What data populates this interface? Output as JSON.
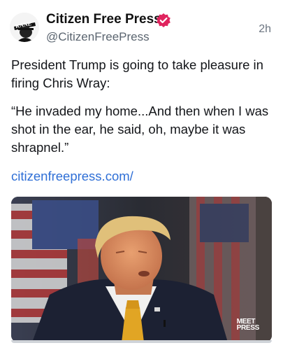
{
  "post": {
    "display_name": "Citizen Free Press",
    "handle": "@CitizenFreePress",
    "time": "2h",
    "avatar_icon": "kane-avatar-icon",
    "verified_icon": "verified-badge-icon",
    "verified_color": "#e0245e",
    "text_line_1": "President Trump is going to take pleasure in firing Chris Wray:",
    "text_line_2": "“He invaded my home...And then when I was shot in the ear, he said, oh, maybe it was shrapnel.”",
    "link_text": "citizenfreepress.com/",
    "link_color": "#2f6fd6",
    "avatar_text": "KANE",
    "media": {
      "description_icon": "video-thumbnail",
      "watermark_line_1": "MEET",
      "watermark_line_2": "PRESS"
    }
  }
}
